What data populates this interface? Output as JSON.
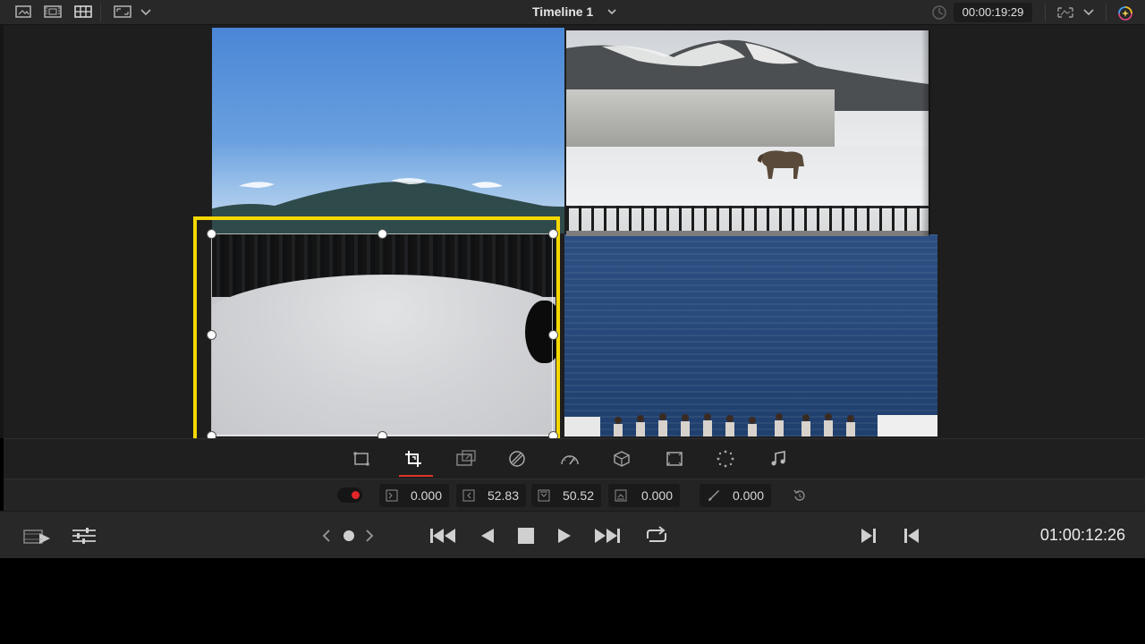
{
  "topbar": {
    "timeline_title": "Timeline 1",
    "duration": "00:00:19:29"
  },
  "viewer": {
    "clips": [
      "sky-mountain",
      "train-elk",
      "lake-crowd",
      "snow-animal"
    ],
    "selection_color": "#f5d800"
  },
  "toolbar": {
    "active_tool": "crop",
    "underline_color": "#e0342a",
    "icons": [
      "transform-icon",
      "crop-icon",
      "dynamic-zoom-icon",
      "composite-icon",
      "speed-icon",
      "stabilization-icon",
      "lens-correction-icon",
      "fade-icon",
      "audio-icon"
    ]
  },
  "params": {
    "keyframe_color": "#e2262a",
    "crop_left": "0.000",
    "crop_right": "52.83",
    "crop_top": "50.52",
    "crop_bottom": "0.000",
    "softness": "0.000"
  },
  "transport": {
    "timecode": "01:00:12:26"
  }
}
